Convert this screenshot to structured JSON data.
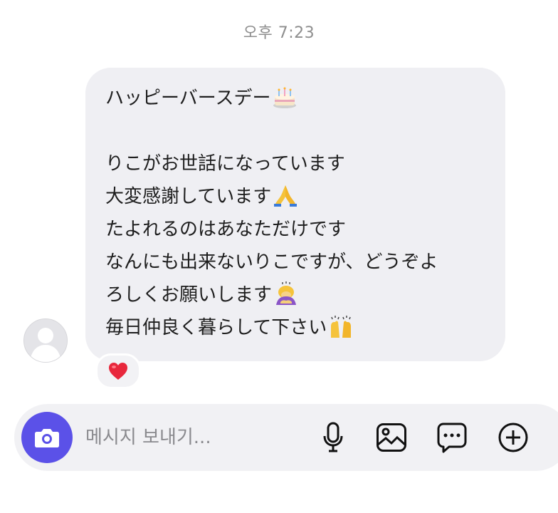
{
  "thread": {
    "timestamp": "오후 7:23"
  },
  "message": {
    "lines": [
      {
        "text": "ハッピーバースデー",
        "emoji": "birthday-cake"
      },
      {
        "text": "",
        "emoji": ""
      },
      {
        "text": "りこがお世話になっています",
        "emoji": ""
      },
      {
        "text": "大変感謝しています",
        "emoji": "folded-hands"
      },
      {
        "text": "たよれるのはあなただけです",
        "emoji": ""
      },
      {
        "text": "なんにも出来ないりこですが、どうぞよ",
        "emoji": ""
      },
      {
        "text": "ろしくお願いします",
        "emoji": "person-bowing"
      },
      {
        "text": "毎日仲良く暮らして下さい",
        "emoji": "raising-hands"
      }
    ],
    "reaction": "red-heart"
  },
  "composer": {
    "placeholder": "메시지 보내기...",
    "icons": [
      "camera-icon",
      "microphone-icon",
      "gallery-icon",
      "sticker-icon",
      "plus-icon"
    ],
    "accent_color": "#5b51e8"
  }
}
